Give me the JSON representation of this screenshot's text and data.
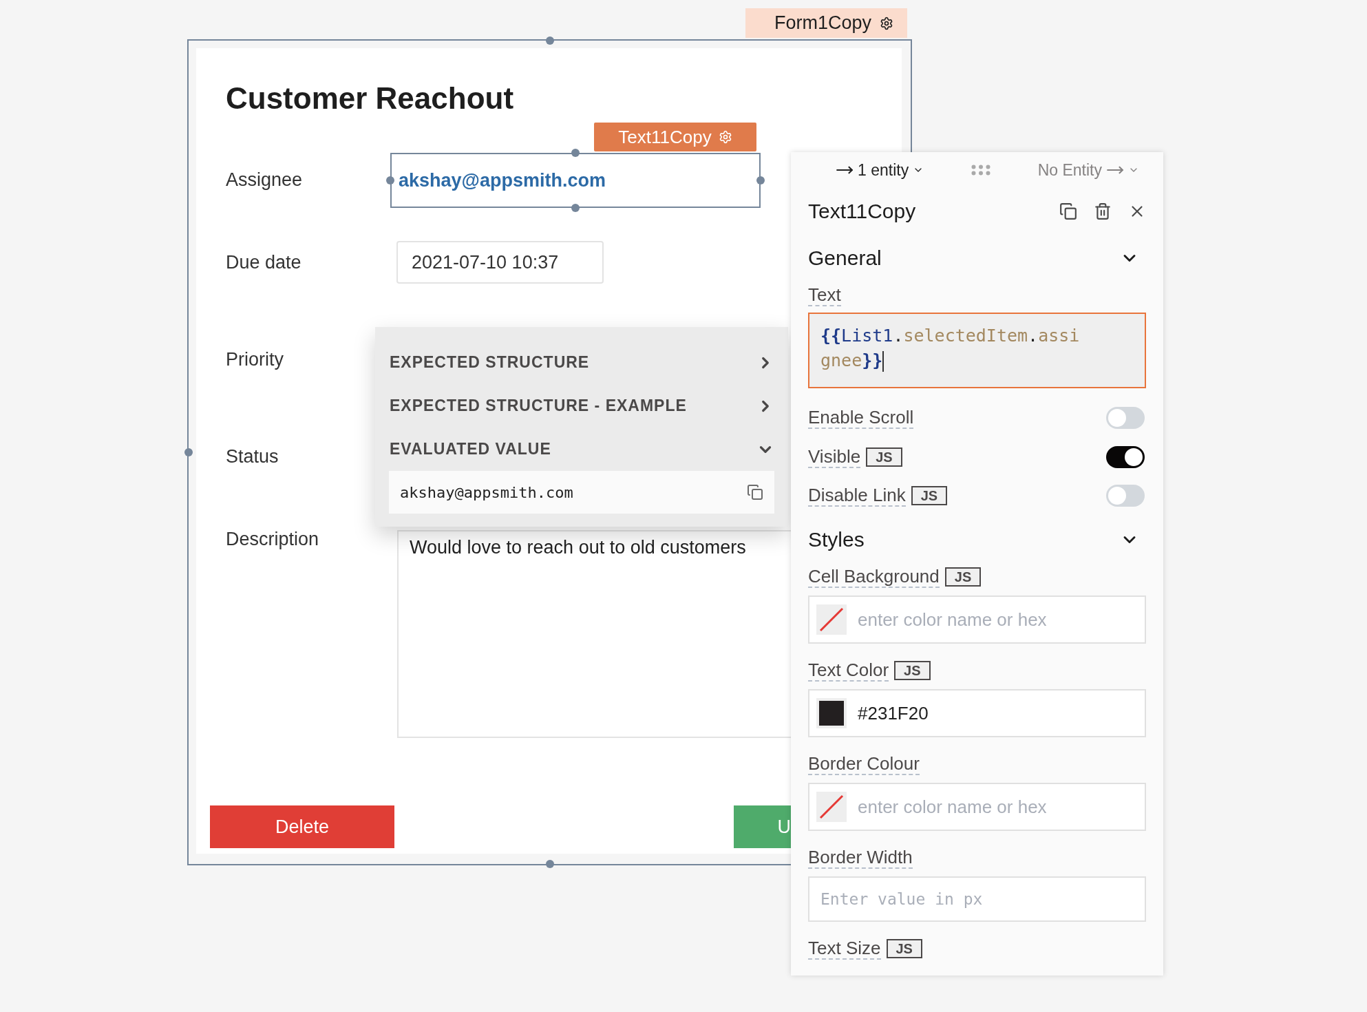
{
  "form": {
    "tag": "Form1Copy",
    "title": "Customer Reachout",
    "fields": [
      {
        "label": "Assignee",
        "kind": "text",
        "value": "akshay@appsmith.com",
        "selected": true,
        "tag": "Text11Copy"
      },
      {
        "label": "Due date",
        "kind": "date",
        "value": "2021-07-10 10:37"
      },
      {
        "label": "Priority",
        "kind": "empty"
      },
      {
        "label": "Status",
        "kind": "empty"
      },
      {
        "label": "Description",
        "kind": "textarea",
        "value": "Would love to reach out to old customers"
      }
    ],
    "buttons": [
      {
        "label": "Delete",
        "kind": "danger"
      },
      {
        "label": "U",
        "kind": "primary"
      }
    ]
  },
  "popover": {
    "sections": [
      {
        "title": "EXPECTED STRUCTURE",
        "expanded": false
      },
      {
        "title": "EXPECTED STRUCTURE - EXAMPLE",
        "expanded": false
      },
      {
        "title": "EVALUATED VALUE",
        "expanded": true,
        "value": "akshay@appsmith.com"
      }
    ]
  },
  "property_pane": {
    "nav": {
      "incoming": "1 entity",
      "outgoing": "No Entity"
    },
    "title": "Text11Copy",
    "sections": [
      {
        "title": "General",
        "expanded": true,
        "properties": [
          {
            "kind": "code",
            "label": "Text",
            "focused": true,
            "tokens": [
              {
                "kind": "brace",
                "text": "{{"
              },
              {
                "kind": "object",
                "text": "List1"
              },
              {
                "kind": "punct",
                "text": "."
              },
              {
                "kind": "property",
                "text": "selectedItem"
              },
              {
                "kind": "punct",
                "text": "."
              },
              {
                "kind": "property",
                "text": "assignee"
              },
              {
                "kind": "brace",
                "text": "}}"
              }
            ]
          },
          {
            "kind": "toggle",
            "label": "Enable Scroll",
            "on": false
          },
          {
            "kind": "toggle",
            "label": "Visible",
            "badge": "JS",
            "on": true
          },
          {
            "kind": "toggle",
            "label": "Disable Link",
            "badge": "JS",
            "on": false
          }
        ]
      },
      {
        "title": "Styles",
        "expanded": true,
        "properties": [
          {
            "kind": "color",
            "label": "Cell Background",
            "badge": "JS",
            "placeholder": "enter color name or hex"
          },
          {
            "kind": "color",
            "label": "Text Color",
            "badge": "JS",
            "value": "#231F20"
          },
          {
            "kind": "color",
            "label": "Border Colour",
            "placeholder": "enter color name or hex"
          },
          {
            "kind": "input",
            "label": "Border Width",
            "placeholder": "Enter value in px"
          },
          {
            "kind": "label",
            "label": "Text Size",
            "badge": "JS"
          }
        ]
      }
    ]
  }
}
